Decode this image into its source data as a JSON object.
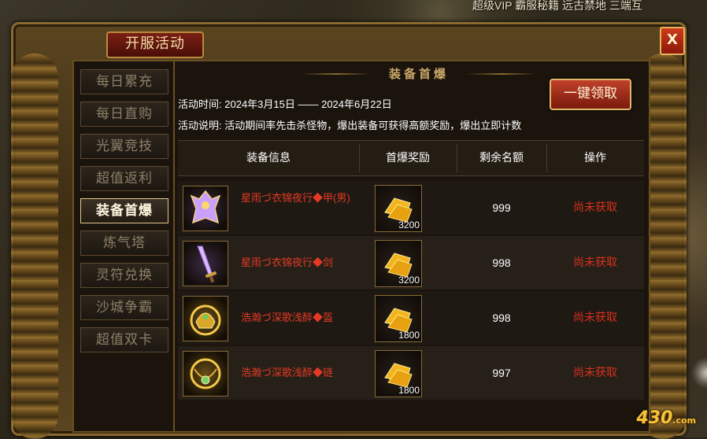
{
  "top_bar": {
    "text": "超级VIP  霸服秘籍  远古禁地  三端互"
  },
  "window": {
    "title": "开服活动",
    "close_label": "X"
  },
  "menu": {
    "items": [
      {
        "label": "每日累充",
        "active": false
      },
      {
        "label": "每日直购",
        "active": false
      },
      {
        "label": "光翼竞技",
        "active": false
      },
      {
        "label": "超值返利",
        "active": false
      },
      {
        "label": "装备首爆",
        "active": true
      },
      {
        "label": "炼气塔",
        "active": false
      },
      {
        "label": "灵符兑换",
        "active": false
      },
      {
        "label": "沙城争霸",
        "active": false
      },
      {
        "label": "超值双卡",
        "active": false
      }
    ]
  },
  "panel": {
    "section_title": "装备首爆",
    "claim_all_label": "一键领取",
    "time_label": "活动时间:",
    "time_value": "2024年3月15日 —— 2024年6月22日",
    "desc_label": "活动说明:",
    "desc_value": "活动期间率先击杀怪物，爆出装备可获得高额奖励，爆出立即计数"
  },
  "table": {
    "headers": [
      "装备信息",
      "首爆奖励",
      "剩余名额",
      "操作"
    ],
    "rows": [
      {
        "item_icon": "armor-icon",
        "item_name": "星雨づ衣锦夜行◆甲(男)",
        "reward_icon": "gold-ingot-icon",
        "reward_count": "3200",
        "remaining": "999",
        "status": "尚未获取"
      },
      {
        "item_icon": "sword-icon",
        "item_name": "星雨づ衣锦夜行◆剑",
        "reward_icon": "gold-ingot-icon",
        "reward_count": "3200",
        "remaining": "998",
        "status": "尚未获取"
      },
      {
        "item_icon": "helmet-icon",
        "item_name": "浩瀚づ深歌浅醉◆盔",
        "reward_icon": "gold-ingot-icon",
        "reward_count": "1800",
        "remaining": "998",
        "status": "尚未获取"
      },
      {
        "item_icon": "necklace-icon",
        "item_name": "浩瀚づ深歌浅醉◆链",
        "reward_icon": "gold-ingot-icon",
        "reward_count": "1800",
        "remaining": "997",
        "status": "尚未获取"
      }
    ]
  },
  "watermark": {
    "text": "430",
    "suffix": ".com"
  },
  "colors": {
    "accent_red": "#e33a24",
    "status_red": "#d8301c",
    "gold": "#caa86a"
  }
}
